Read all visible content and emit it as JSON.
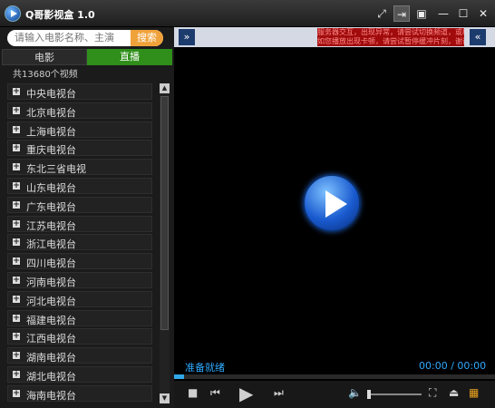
{
  "window": {
    "title": "Q哥影视盒 1.0"
  },
  "titlebar_icons": [
    "expand-icon",
    "pin-icon",
    "window-icon",
    "minimize-icon",
    "maximize-icon",
    "close-icon"
  ],
  "search": {
    "placeholder": "请输入电影名称、主演",
    "button_label": "搜索"
  },
  "tabs": [
    {
      "label": "电影",
      "active": false
    },
    {
      "label": "直播",
      "active": true
    }
  ],
  "video_count": "共13680个视频",
  "channels": [
    "中央电视台",
    "北京电视台",
    "上海电视台",
    "重庆电视台",
    "东北三省电视",
    "山东电视台",
    "广东电视台",
    "江苏电视台",
    "浙江电视台",
    "四川电视台",
    "河南电视台",
    "河北电视台",
    "福建电视台",
    "江西电视台",
    "湖南电视台",
    "湖北电视台",
    "海南电视台"
  ],
  "ticker": {
    "lines": [
      "服务器交互，出现异常，请尝试切换频道，或稍候再试",
      "如您播放出现卡顿，请尝试暂停缓冲片刻，谢谢支持"
    ]
  },
  "player": {
    "status": "准备就绪",
    "time": "00:00 / 00:00",
    "progress": 0.03,
    "volume": 0.03
  },
  "colors": {
    "accent": "#2fa9ff",
    "live_tab": "#2f8f1a",
    "search_button": "#f0a23a",
    "ticker_bg": "#a10b0b"
  }
}
